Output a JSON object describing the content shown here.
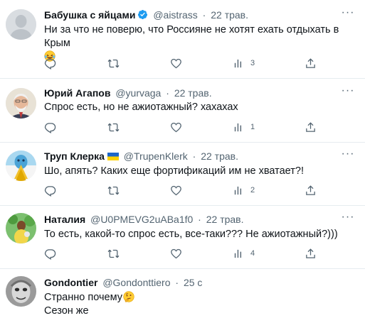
{
  "tweets": [
    {
      "name": "Бабушка с яйцами",
      "handle": "@aistrass",
      "dot": "·",
      "time": "22 трав.",
      "text": "Ни за что не поверю, что Россияне не хотят ехать отдыхать в Крым",
      "text2": "",
      "views": "3",
      "icons": [
        "reply-icon",
        "retweet-icon",
        "like-icon",
        "views-icon",
        "share-icon"
      ],
      "emoji": "rolling-on-floor-laughing"
    },
    {
      "name": "Юрий Агапов",
      "handle": "@yurvaga",
      "dot": "·",
      "time": "22 трав.",
      "text": "Спрос есть, но не ажиотажный? хахахах",
      "text2": "",
      "views": "1"
    },
    {
      "name": "Труп Клерка",
      "handle": "@TrupenKlerk",
      "dot": "·",
      "time": "22 трав.",
      "text": "Шо, апять? Каких еще фортификаций им не хватает?!",
      "text2": "",
      "views": "2"
    },
    {
      "name": "Наталия",
      "handle": "@U0PMEVG2uABa1f0",
      "dot": "·",
      "time": "22 трав.",
      "text": "То есть, какой-то спрос есть, все-таки??? Не ажиотажный?)))",
      "text2": "",
      "views": "4"
    },
    {
      "name": "Gondontier",
      "handle": "@Gondonttiero",
      "dot": "·",
      "time": "25 с",
      "text": "Странно почему",
      "text2": "Сезон же",
      "views": ""
    }
  ],
  "colors": {
    "verified": "#1d9bf0",
    "muted": "#536471",
    "separator": "#e6ecf0"
  },
  "more_label": "···"
}
